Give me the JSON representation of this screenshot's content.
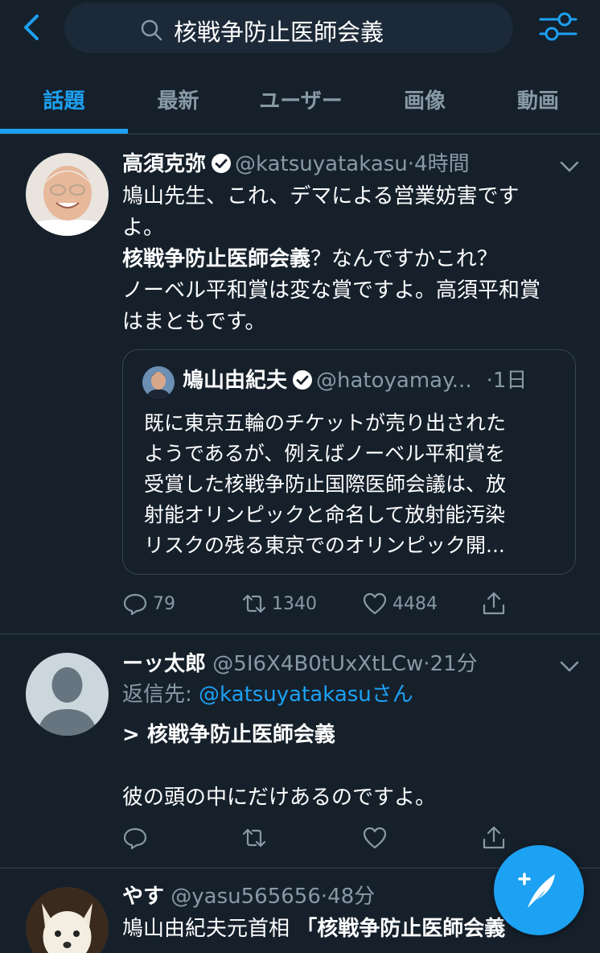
{
  "search": {
    "query": "核戦争防止医師会義"
  },
  "tabs": [
    {
      "label": "話題",
      "active": true
    },
    {
      "label": "最新"
    },
    {
      "label": "ユーザー"
    },
    {
      "label": "画像"
    },
    {
      "label": "動画"
    }
  ],
  "tweets": [
    {
      "name": "高須克弥",
      "verified": true,
      "handle": "@katsuyatakasu",
      "dot": "·",
      "time": "4時間",
      "body_lines": [
        "鳩山先生、これ、デマによる営業妨害です",
        "よ。",
        "核戦争防止医師会義",
        "？なんですかこれ？",
        "ノーベル平和賞は変な賞ですよ。高須平和賞",
        "はまともです。"
      ],
      "quote": {
        "name": "鳩山由紀夫",
        "handle": "@hatoyamay...",
        "time": "·1日",
        "lines": [
          "既に東京五輪のチケットが売り出された",
          "ようであるが、例えばノーベル平和賞を",
          "受賞した核戦争防止国際医師会議は、放",
          "射能オリンピックと命名して放射能汚染",
          "リスクの残る東京でのオリンピック開..."
        ]
      },
      "replies": "79",
      "retweets": "1340",
      "likes": "4484"
    },
    {
      "name": "ーッ太郎",
      "handle": "@5I6X4B0tUxXtLCw",
      "dot": "·",
      "time": "21分",
      "reply_prefix": "返信先: ",
      "reply_mention": "@katsuyatakasuさん",
      "body_lines": [
        "> 核戦争防止医師会義",
        "彼の頭の中にだけあるのですよ。"
      ]
    },
    {
      "name": "やす",
      "handle": "@yasu565656",
      "dot": "·",
      "time": "48分",
      "body_prefix": "鳩山由紀夫元首相 ",
      "body_bold": "「核戦争防止医師会義"
    }
  ],
  "colors": {
    "background": "#15202b",
    "accent": "#1da1f2",
    "secondary_text": "#8899a6",
    "divider": "#38444d"
  }
}
